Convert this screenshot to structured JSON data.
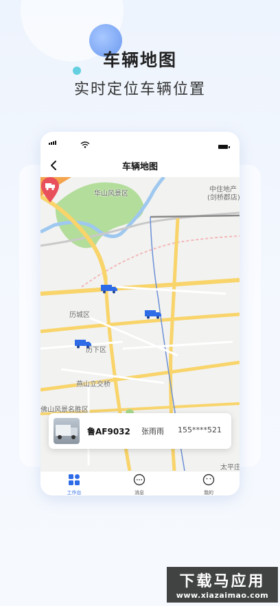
{
  "header": {
    "title": "车辆地图",
    "subtitle": "实时定位车辆位置"
  },
  "phone": {
    "nav": {
      "title": "车辆地图"
    },
    "map": {
      "labels": [
        "华山风景区",
        "中住地产",
        "(剑桥郡店)",
        "历城区",
        "历下区",
        "燕山立交桥",
        "佛山风景名胜区",
        "太平庄"
      ]
    },
    "vehicle_card": {
      "plate": "鲁AF9032",
      "driver": "张雨雨",
      "phone": "155****521"
    },
    "tabs": [
      {
        "label": "工作台",
        "active": true
      },
      {
        "label": "消息",
        "active": false
      },
      {
        "label": "我的",
        "active": false
      }
    ]
  },
  "watermark": {
    "main": "下载马应用",
    "url": "www.xiazaimao.com"
  },
  "colors": {
    "accent": "#2e6be6",
    "pin": "#e8505b",
    "truck": "#2e6be6",
    "road_major": "#f8d46a"
  }
}
